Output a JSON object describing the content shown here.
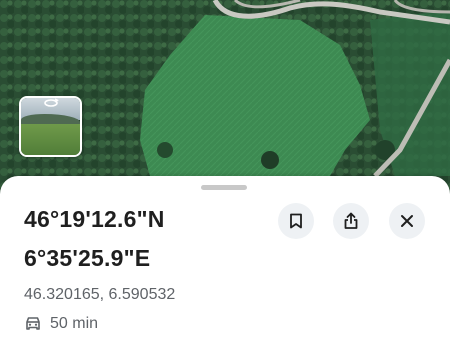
{
  "location": {
    "latitude_dms": "46°19'12.6\"N",
    "longitude_dms": "6°35'25.9\"E",
    "decimal_coordinates": "46.320165, 6.590532"
  },
  "travel": {
    "mode_icon": "car-icon",
    "duration": "50 min"
  },
  "actions": {
    "save_icon": "bookmark-icon",
    "share_icon": "share-icon",
    "close_icon": "close-icon"
  },
  "colors": {
    "sheet_background": "#ffffff",
    "primary_text": "#1f1f1f",
    "secondary_text": "#5f6368",
    "button_background": "#eef1f4"
  }
}
